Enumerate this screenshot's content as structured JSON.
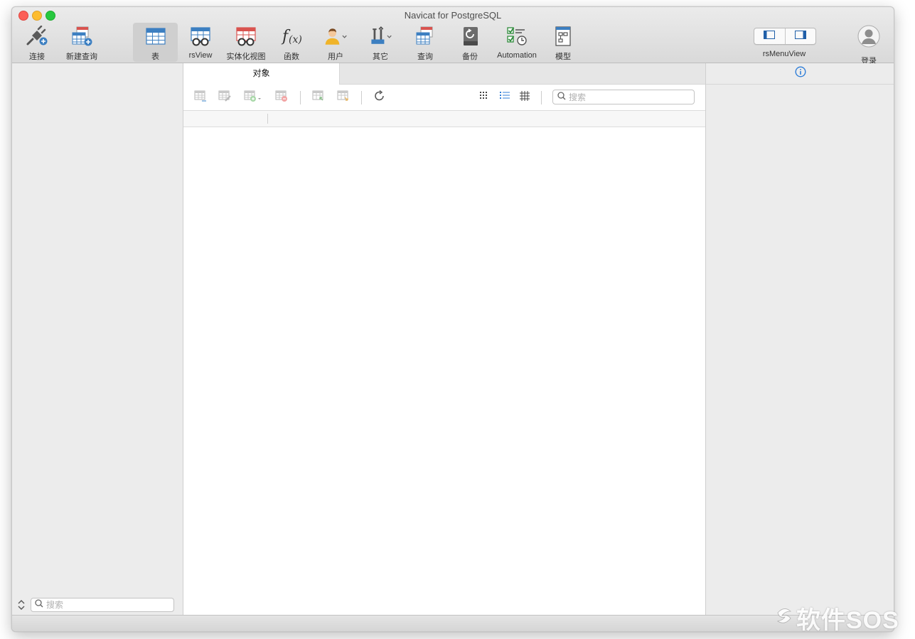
{
  "window": {
    "title": "Navicat for PostgreSQL"
  },
  "toolbar": {
    "items": [
      {
        "label": "连接",
        "icon": "connection-plug-icon"
      },
      {
        "label": "新建查询",
        "icon": "new-query-icon"
      },
      {
        "label": "表",
        "icon": "table-icon",
        "active": true
      },
      {
        "label": "rsView",
        "icon": "view-glasses-icon"
      },
      {
        "label": "实体化视图",
        "icon": "materialized-view-icon"
      },
      {
        "label": "函数",
        "icon": "function-fx-icon"
      },
      {
        "label": "用户",
        "icon": "user-icon"
      },
      {
        "label": "其它",
        "icon": "tools-icon"
      },
      {
        "label": "查询",
        "icon": "query-icon"
      },
      {
        "label": "备份",
        "icon": "backup-icon"
      },
      {
        "label": "Automation",
        "icon": "automation-icon"
      },
      {
        "label": "模型",
        "icon": "model-icon"
      }
    ],
    "view_toggle_label": "rsMenuView",
    "login_label": "登录"
  },
  "sidebar": {
    "search_placeholder": "搜索"
  },
  "main": {
    "tab_label": "对象",
    "search_placeholder": "搜索"
  },
  "watermark": {
    "text": "软件SOS"
  },
  "colors": {
    "accent_blue": "#3c7fc1",
    "table_red": "#d9534f",
    "info_blue": "#2f7ed8"
  }
}
